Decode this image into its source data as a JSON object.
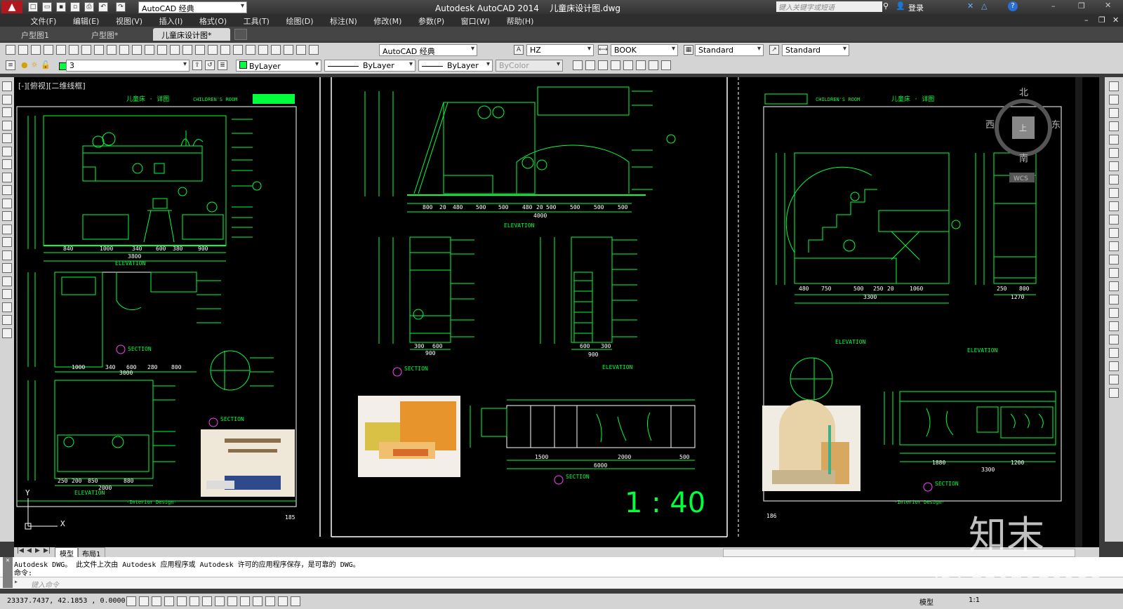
{
  "window": {
    "app_title": "Autodesk AutoCAD 2014",
    "doc_title": "儿童床设计图.dwg",
    "workspace": "AutoCAD 经典",
    "search_placeholder": "键入关键字或短语",
    "login": "登录"
  },
  "menu": [
    "文件(F)",
    "编辑(E)",
    "视图(V)",
    "插入(I)",
    "格式(O)",
    "工具(T)",
    "绘图(D)",
    "标注(N)",
    "修改(M)",
    "参数(P)",
    "窗口(W)",
    "帮助(H)"
  ],
  "doc_tabs": [
    "户型图1",
    "户型图*",
    "儿童床设计图*"
  ],
  "toolbar1": {
    "workspace": "AutoCAD 经典",
    "text_style": "HZ",
    "dim_style": "BOOK",
    "table_style": "Standard",
    "multileader_style": "Standard"
  },
  "toolbar2": {
    "layer": "3",
    "color": "ByLayer",
    "linetype": "ByLayer",
    "lineweight": "ByLayer",
    "plot_style": "ByColor"
  },
  "viewport_label": "[-][俯视][二维线框]",
  "viewcube": {
    "north": "北",
    "south": "南",
    "west": "西",
    "east": "东",
    "top": "上",
    "ucs": "WCS"
  },
  "drawing": {
    "left_sheet": {
      "header": "儿童床 · 详图",
      "header_en": "CHILDREN'S ROOM",
      "elevation1_label": "ELEVATION",
      "elevation1_dims": [
        "840",
        "1000",
        "340",
        "600",
        "380",
        "900"
      ],
      "elevation1_total": "3800",
      "section_a": "SECTION",
      "section_a_dims": [
        "1000",
        "340",
        "600",
        "280",
        "800"
      ],
      "section_a_total": "3000",
      "section_b": "SECTION",
      "elevation2_label": "ELEVATION",
      "elevation2_dims": [
        "250",
        "200",
        "850",
        "880"
      ],
      "elevation2_total": "2000",
      "footer": "-Interior Design-",
      "page": "185"
    },
    "center_sheet": {
      "elev_label": "ELEVATION",
      "elev_dims": [
        "800",
        "20",
        "480",
        "500",
        "500",
        "480",
        "20",
        "500",
        "500",
        "500",
        "500"
      ],
      "elev_total": "4000",
      "section_b": "SECTION",
      "section_b_dims": [
        "300",
        "600"
      ],
      "section_b_total": "900",
      "elev2_label": "ELEVATION",
      "elev2_dims": [
        "600",
        "300"
      ],
      "elev2_total": "900",
      "section_a": "SECTION",
      "plan_dims": [
        "1500",
        "2000",
        "500"
      ],
      "plan_total": "6000",
      "scale": "1 : 40"
    },
    "right_sheet": {
      "header": "儿童床 · 详图",
      "header_en": "CHILDREN'S ROOM",
      "elev_dims": [
        "480",
        "750",
        "500",
        "250",
        "20",
        "1060"
      ],
      "elev_total": "3300",
      "elev_label": "ELEVATION",
      "elev2_dims": [
        "250",
        "800"
      ],
      "elev2_total": "1270",
      "elev2_label": "ELEVATION",
      "section_dims": [
        "1880",
        "1200"
      ],
      "section_total": "3300",
      "section_label": "SECTION",
      "footer": "-Interior Design-",
      "page": "186"
    }
  },
  "layout_tabs": [
    "模型",
    "布局1"
  ],
  "command_lines": [
    "Autodesk DWG。  此文件上次由 Autodesk 应用程序或 Autodesk 许可的应用程序保存，是可靠的 DWG。",
    "命令:"
  ],
  "command_placeholder": "键入命令",
  "coords": "23337.7437, 42.1853 , 0.0000",
  "status_right": {
    "model": "模型",
    "scale": "1:1"
  },
  "watermark": {
    "logo": "知末",
    "id": "ID: 1102018955"
  },
  "colors": {
    "cad_green": "#00ff3c",
    "cad_white": "#ffffff",
    "cad_magenta": "#ff40ff",
    "accent_red": "#c8102e"
  }
}
